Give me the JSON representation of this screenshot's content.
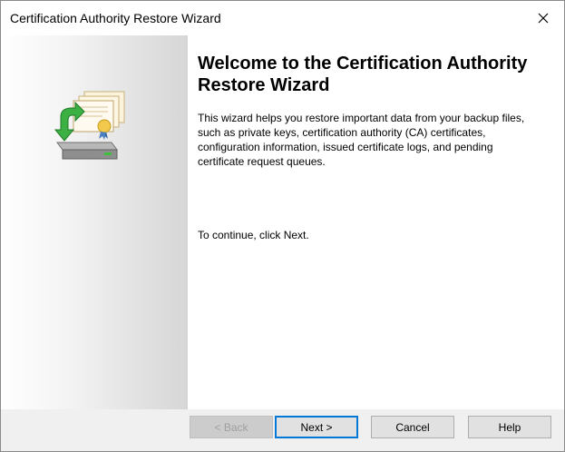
{
  "window": {
    "title": "Certification Authority Restore Wizard"
  },
  "sidepanel": {
    "icon": "certificate-restore-icon"
  },
  "content": {
    "heading": "Welcome to the Certification Authority Restore Wizard",
    "description": "This wizard helps you restore important data from your backup files, such as private keys, certification authority (CA) certificates, configuration information, issued certificate logs, and pending certificate request queues.",
    "continue_text": "To continue, click Next."
  },
  "buttons": {
    "back": "< Back",
    "next": "Next >",
    "cancel": "Cancel",
    "help": "Help"
  },
  "colors": {
    "accent": "#0078d7",
    "footer_bg": "#f0f0f0",
    "button_bg": "#e1e1e1"
  }
}
